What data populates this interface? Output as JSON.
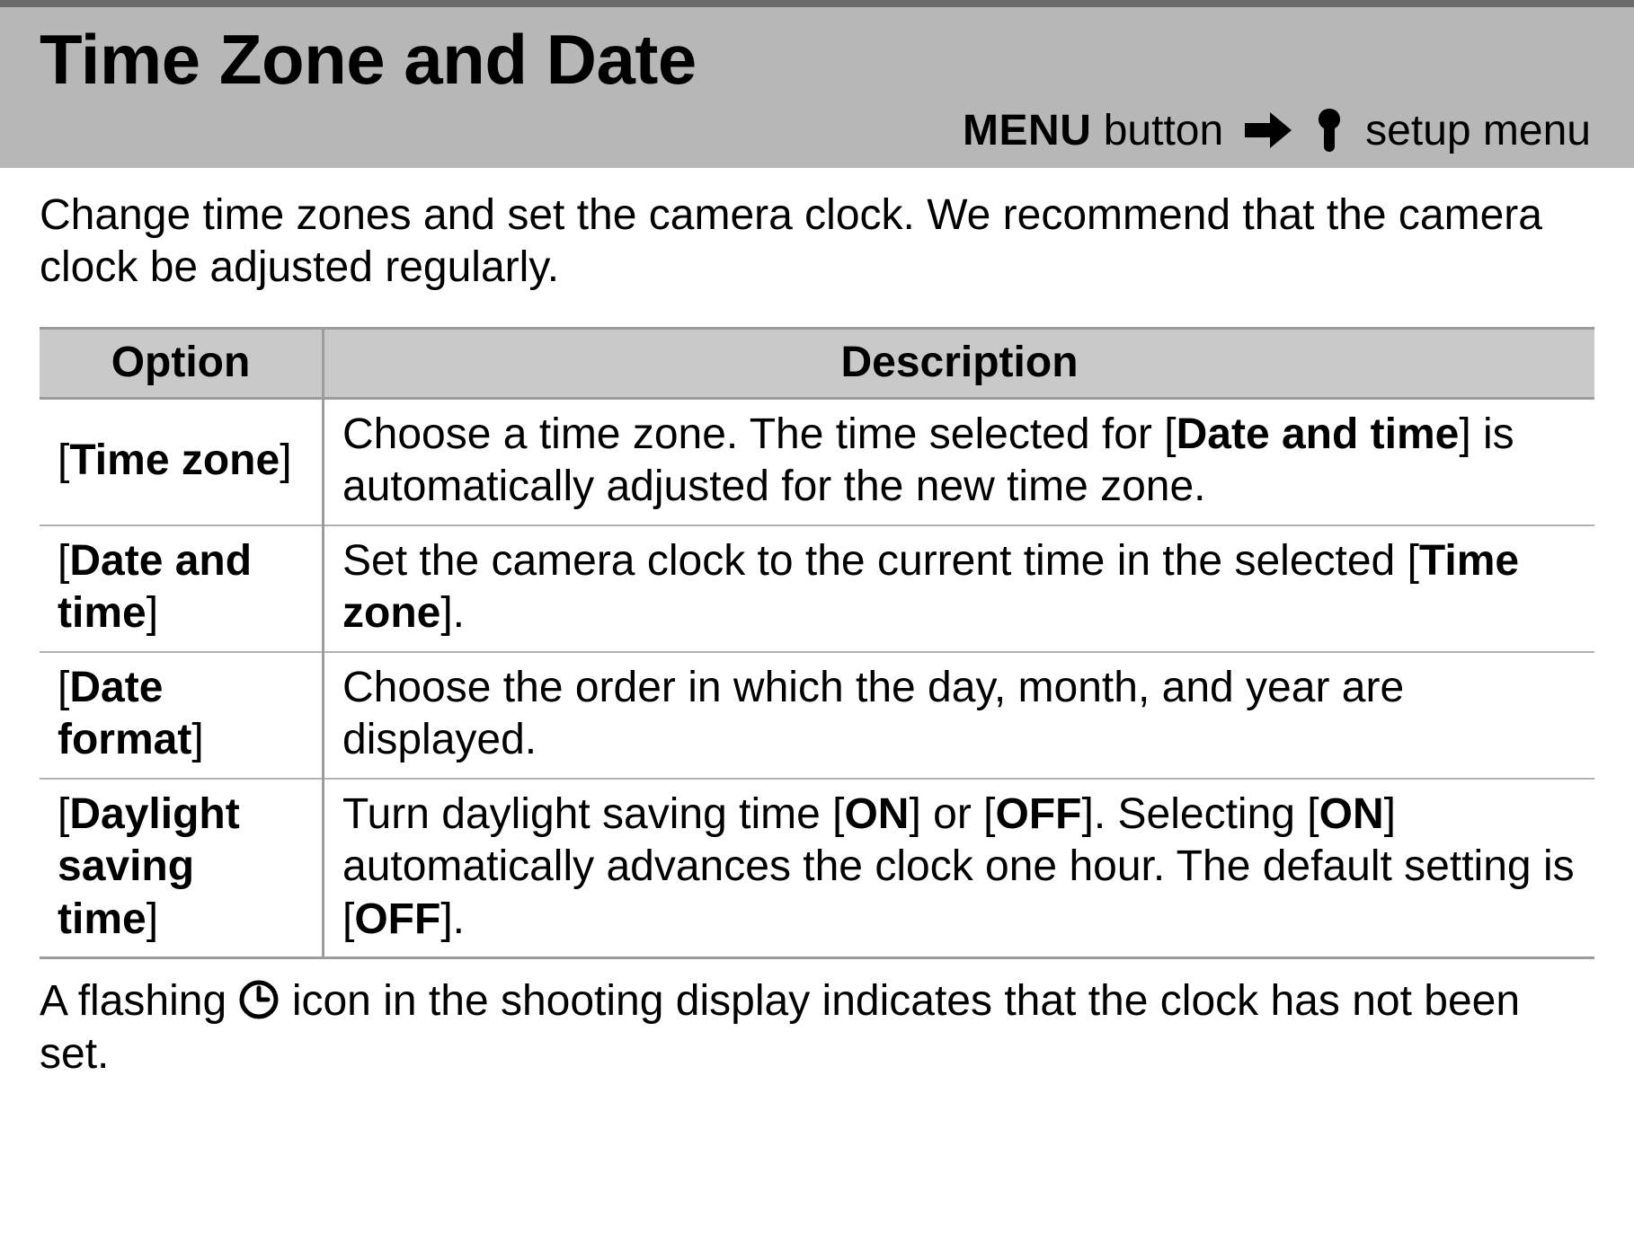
{
  "header": {
    "title": "Time Zone and Date",
    "breadcrumb": {
      "menu_label": "MENU",
      "button_text": "button",
      "setup_menu": "setup menu"
    }
  },
  "intro": "Change time zones and set the camera clock. We recommend that the camera clock be adjusted regularly.",
  "table": {
    "headers": {
      "option": "Option",
      "description": "Description"
    },
    "rows": [
      {
        "option_html": "[<span class='b'>Time zone</span>]",
        "desc_html": "Choose a time zone. The time selected for [<span class='b'>Date and time</span>] is automatically adjusted for the new time zone."
      },
      {
        "option_html": "[<span class='b'>Date and time</span>]",
        "desc_html": "Set the camera clock to the current time in the selected [<span class='b'>Time zone</span>]."
      },
      {
        "option_html": "[<span class='b'>Date format</span>]",
        "desc_html": "Choose the order in which the day, month, and year are displayed."
      },
      {
        "option_html": "[<span class='b'>Daylight saving time</span>]",
        "desc_html": "Turn daylight saving time [<span class='b'>ON</span>] or [<span class='b'>OFF</span>]. Selecting [<span class='b'>ON</span>] automatically advances the clock one hour. The default setting is [<span class='b'>OFF</span>]."
      }
    ]
  },
  "footnote": {
    "before": "A flashing ",
    "after": " icon in the shooting display indicates that the clock has not been set."
  }
}
